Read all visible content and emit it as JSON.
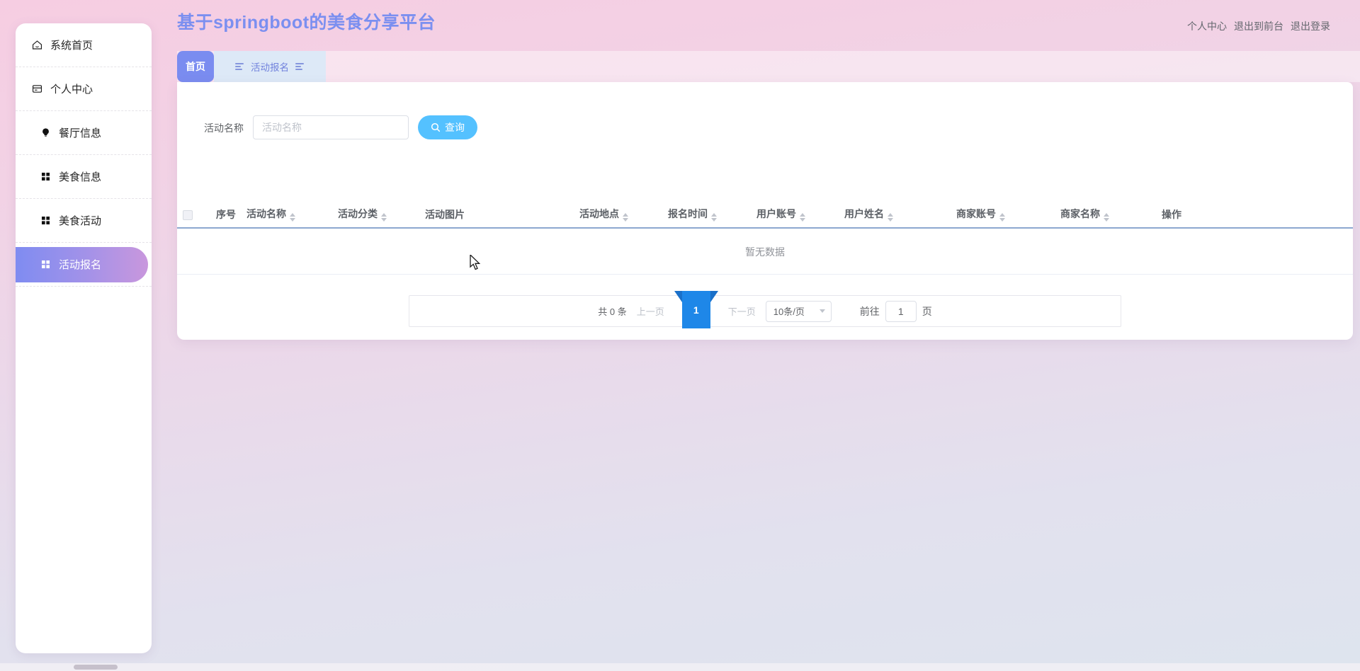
{
  "app": {
    "title": "基于springboot的美食分享平台"
  },
  "header": {
    "links": [
      {
        "label": "个人中心"
      },
      {
        "label": "退出到前台"
      },
      {
        "label": "退出登录"
      }
    ]
  },
  "sidebar": {
    "items": [
      {
        "label": "系统首页",
        "icon": "home-icon",
        "active": false
      },
      {
        "label": "个人中心",
        "icon": "panel-icon",
        "active": false
      },
      {
        "label": "餐厅信息",
        "icon": "bulb-icon",
        "active": false
      },
      {
        "label": "美食信息",
        "icon": "grid-icon",
        "active": false
      },
      {
        "label": "美食活动",
        "icon": "grid-icon",
        "active": false
      },
      {
        "label": "活动报名",
        "icon": "grid-icon",
        "active": true
      }
    ]
  },
  "tabs": [
    {
      "label": "首页",
      "active": true
    },
    {
      "label": "活动报名",
      "active": false
    }
  ],
  "search": {
    "label": "活动名称",
    "placeholder": "活动名称",
    "button_label": "查询"
  },
  "table": {
    "select_all_checked": false,
    "columns": [
      {
        "label": "序号",
        "sortable": false
      },
      {
        "label": "活动名称",
        "sortable": true
      },
      {
        "label": "活动分类",
        "sortable": true
      },
      {
        "label": "活动图片",
        "sortable": false
      },
      {
        "label": "活动地点",
        "sortable": true
      },
      {
        "label": "报名时间",
        "sortable": true
      },
      {
        "label": "用户账号",
        "sortable": true
      },
      {
        "label": "用户姓名",
        "sortable": true
      },
      {
        "label": "商家账号",
        "sortable": true
      },
      {
        "label": "商家名称",
        "sortable": true
      },
      {
        "label": "操作",
        "sortable": false
      }
    ],
    "rows": [],
    "empty_text": "暂无数据"
  },
  "pagination": {
    "total": "共 0 条",
    "prev": "上一页",
    "current_page": "1",
    "next": "下一页",
    "page_size": "10条/页",
    "goto_label": "前往",
    "goto_value": "1",
    "goto_unit": "页"
  },
  "colors": {
    "title": "#7b8ff0",
    "tab_active_bg": "#7a8cf0",
    "tab_bg": "#dde9f7",
    "sidebar_active_start": "#7f8cf1",
    "sidebar_active_end": "#c997dd",
    "search_button_bg": "#54c1ff",
    "page_ribbon": "#1e87e8",
    "table_header_border": "#8ca8d0"
  }
}
